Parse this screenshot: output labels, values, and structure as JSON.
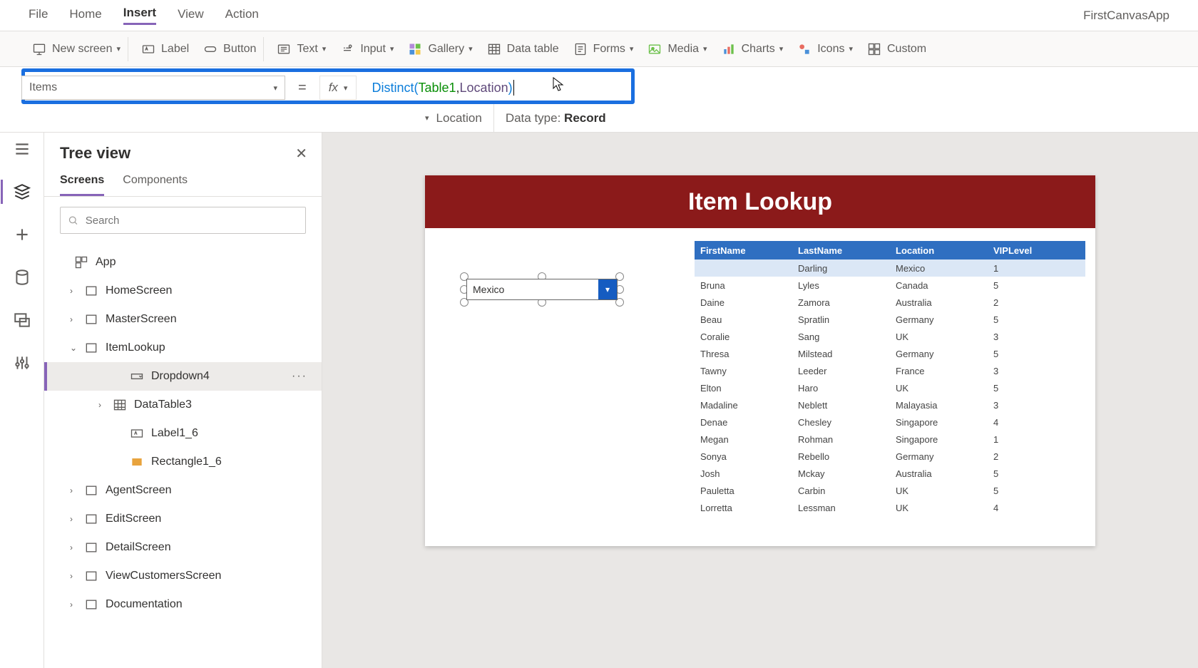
{
  "menu": {
    "items": [
      "File",
      "Home",
      "Insert",
      "View",
      "Action"
    ],
    "active": "Insert"
  },
  "appName": "FirstCanvasApp",
  "ribbon": {
    "newScreen": "New screen",
    "label": "Label",
    "button": "Button",
    "text": "Text",
    "input": "Input",
    "gallery": "Gallery",
    "dataTable": "Data table",
    "forms": "Forms",
    "media": "Media",
    "charts": "Charts",
    "icons": "Icons",
    "custom": "Custom"
  },
  "formula": {
    "property": "Items",
    "equals": "=",
    "fx": "fx",
    "func": "Distinct",
    "table": "Table1",
    "col": "Location"
  },
  "info": {
    "col": "Location",
    "dt_label": "Data type:",
    "dt_value": "Record"
  },
  "tree": {
    "title": "Tree view",
    "tabs": {
      "screens": "Screens",
      "components": "Components"
    },
    "searchPlaceholder": "Search",
    "nodes": {
      "app": "App",
      "home": "HomeScreen",
      "master": "MasterScreen",
      "itemlookup": "ItemLookup",
      "dropdown4": "Dropdown4",
      "datatable3": "DataTable3",
      "label16": "Label1_6",
      "rect16": "Rectangle1_6",
      "agent": "AgentScreen",
      "edit": "EditScreen",
      "detail": "DetailScreen",
      "viewcust": "ViewCustomersScreen",
      "docs": "Documentation"
    }
  },
  "canvas": {
    "title": "Item Lookup",
    "dropdownValue": "Mexico",
    "table": {
      "headers": [
        "FirstName",
        "LastName",
        "Location",
        "VIPLevel"
      ],
      "rows": [
        [
          "",
          "Darling",
          "Mexico",
          "1"
        ],
        [
          "Bruna",
          "Lyles",
          "Canada",
          "5"
        ],
        [
          "Daine",
          "Zamora",
          "Australia",
          "2"
        ],
        [
          "Beau",
          "Spratlin",
          "Germany",
          "5"
        ],
        [
          "Coralie",
          "Sang",
          "UK",
          "3"
        ],
        [
          "Thresa",
          "Milstead",
          "Germany",
          "5"
        ],
        [
          "Tawny",
          "Leeder",
          "France",
          "3"
        ],
        [
          "Elton",
          "Haro",
          "UK",
          "5"
        ],
        [
          "Madaline",
          "Neblett",
          "Malayasia",
          "3"
        ],
        [
          "Denae",
          "Chesley",
          "Singapore",
          "4"
        ],
        [
          "Megan",
          "Rohman",
          "Singapore",
          "1"
        ],
        [
          "Sonya",
          "Rebello",
          "Germany",
          "2"
        ],
        [
          "Josh",
          "Mckay",
          "Australia",
          "5"
        ],
        [
          "Pauletta",
          "Carbin",
          "UK",
          "5"
        ],
        [
          "Lorretta",
          "Lessman",
          "UK",
          "4"
        ]
      ]
    }
  }
}
